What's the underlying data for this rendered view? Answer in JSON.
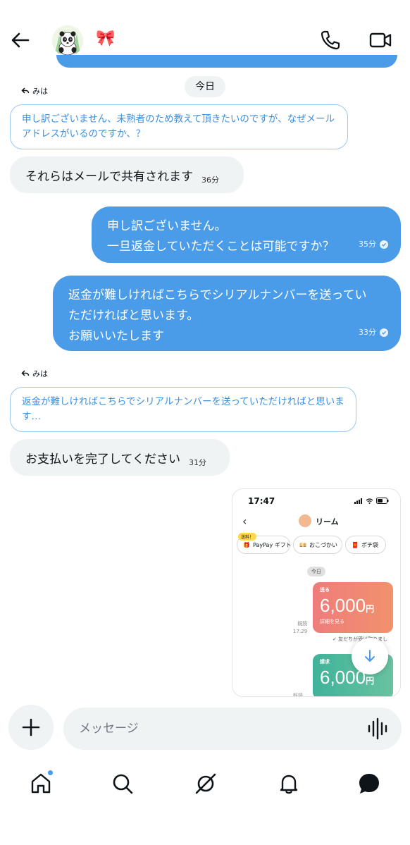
{
  "header": {
    "name_emoji": "🎀"
  },
  "messages": {
    "date_label": "今日",
    "reply1": {
      "label": "みは",
      "quote": "申し訳ございません、未熟者のため教えて頂きたいのですが、なぜメールアドレスがいるのですか、？"
    },
    "in1": {
      "text": "それらはメールで共有されます",
      "time": "36分"
    },
    "out1": {
      "line1": "申し訳ございません。",
      "line2": "一旦返金していただくことは可能ですか？",
      "time": "35分"
    },
    "out2": {
      "line1": "返金が難しければこちらでシリアルナンバーを送ってい",
      "line2": "ただければと思います。",
      "line3": "お願いいたします",
      "time": "33分"
    },
    "reply2": {
      "label": "みは",
      "quote": "返金が難しければこちらでシリアルナンバーを送っていただければと思います…"
    },
    "in2": {
      "text": "お支払いを完了してください",
      "time": "31分"
    }
  },
  "screenshot": {
    "time": "17:47",
    "contact": "リーム",
    "chip_badge": "送料！",
    "chip1": "PayPay ギフト",
    "chip2": "おこづかい",
    "chip3": "ポチ袋",
    "today": "今日",
    "card1": {
      "label": "送る",
      "amount": "6,000",
      "unit": "円",
      "link": "詳細を見る",
      "read": "既読",
      "read_time": "17:29"
    },
    "note": "✓ 友だちが受け取りまし",
    "card2": {
      "label": "請求",
      "amount": "6,000",
      "unit": "円",
      "read": "既読"
    }
  },
  "composer": {
    "placeholder": "メッセージ"
  },
  "colors": {
    "accent": "#4a9be8",
    "bubble_in": "#eff3f4",
    "quote_text": "#3d8fdc"
  },
  "icons": {
    "back": "arrow-left-icon",
    "call": "phone-icon",
    "video": "video-camera-icon",
    "plus": "plus-icon",
    "voice": "voice-wave-icon",
    "home": "home-icon",
    "search": "search-icon",
    "grok": "slash-circle-icon",
    "notifications": "bell-icon",
    "messages": "message-bubble-icon",
    "scroll_down": "arrow-down-icon"
  }
}
